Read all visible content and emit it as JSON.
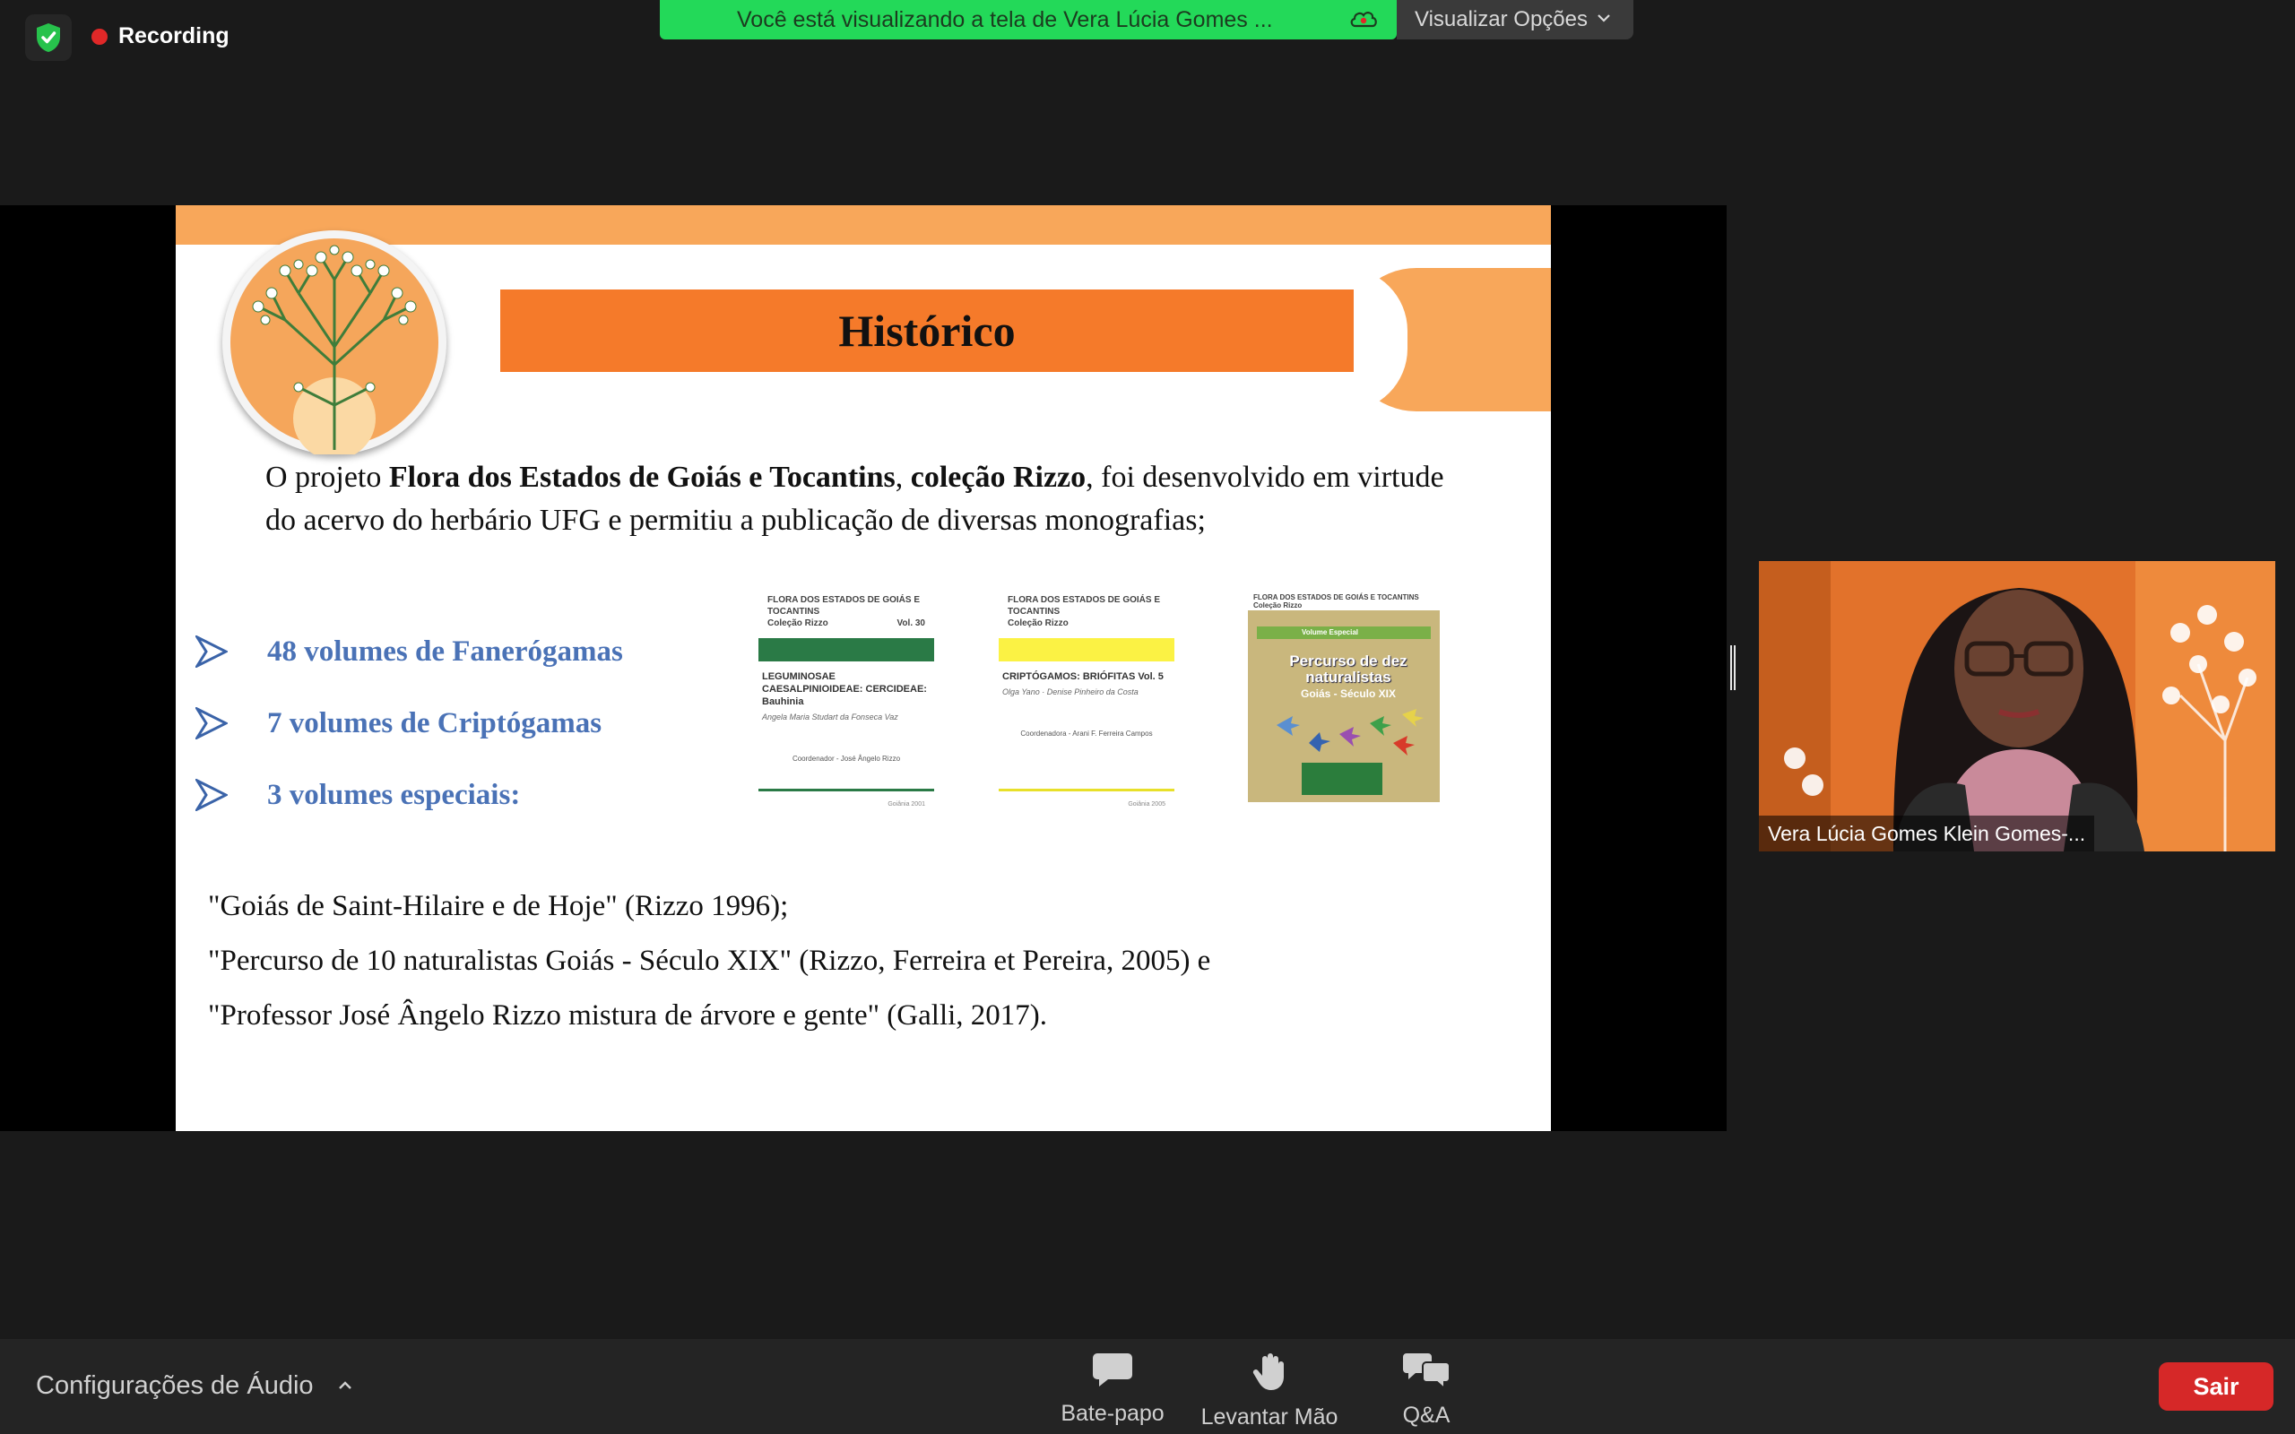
{
  "app": {
    "recording_label": "Recording",
    "share_banner_text": "Você está visualizando a tela de Vera Lúcia Gomes ...",
    "view_options_label": "Visualizar Opções",
    "colors": {
      "banner_green": "#23d959",
      "leave_red": "#d62828",
      "slide_orange": "#f57a2a",
      "bullet_blue": "#4a72b6"
    }
  },
  "slide": {
    "title": "Histórico",
    "intro": {
      "part1": "O projeto ",
      "bold1": "Flora dos Estados de Goiás e Tocantins",
      "part2": ", ",
      "bold2": "coleção Rizzo",
      "part3": ", foi desenvolvido em virtude do acervo do herbário UFG e permitiu a publicação de  diversas monografias;"
    },
    "bullets": [
      "48 volumes de Fanerógamas",
      "7 volumes de Criptógamas",
      "3 volumes especiais:"
    ],
    "books": [
      {
        "header": "FLORA DOS ESTADOS DE GOIÁS E TOCANTINS",
        "collection": "Coleção Rizzo",
        "volume": "Vol. 30",
        "title": "LEGUMINOSAE CAESALPINIOIDEAE: CERCIDEAE: Bauhinia",
        "authors": "Angela Maria Studart da Fonseca Vaz",
        "coordinator": "Coordenador - José Ângelo Rizzo",
        "footer": "Goiânia 2001"
      },
      {
        "header": "FLORA DOS ESTADOS DE GOIÁS E TOCANTINS",
        "collection": "Coleção Rizzo",
        "volume": "Vol. 5",
        "title": "CRIPTÓGAMOS: BRIÓFITAS",
        "authors": "Olga Yano · Denise Pinheiro da Costa",
        "coordinator": "Coordenadora - Arani F. Ferreira Campos",
        "footer": "Goiânia 2005"
      },
      {
        "header": "FLORA DOS ESTADOS DE GOIÁS E TOCANTINS",
        "collection": "Coleção Rizzo",
        "special": "Volume Especial",
        "title": "Percurso de dez naturalistas",
        "subtitle": "Goiás - Século XIX"
      }
    ],
    "references": [
      "\"Goiás de Saint-Hilaire e de Hoje\" (Rizzo 1996);",
      "\"Percurso de 10 naturalistas Goiás - Século XIX\" (Rizzo, Ferreira et Pereira, 2005) e",
      "\"Professor José Ângelo Rizzo mistura de árvore e gente\" (Galli, 2017)."
    ]
  },
  "participant": {
    "name": "Vera Lúcia Gomes Klein Gomes-..."
  },
  "toolbar": {
    "audio_settings": "Configurações de Áudio",
    "chat": "Bate-papo",
    "raise_hand": "Levantar Mão",
    "qa": "Q&A",
    "leave": "Sair"
  }
}
